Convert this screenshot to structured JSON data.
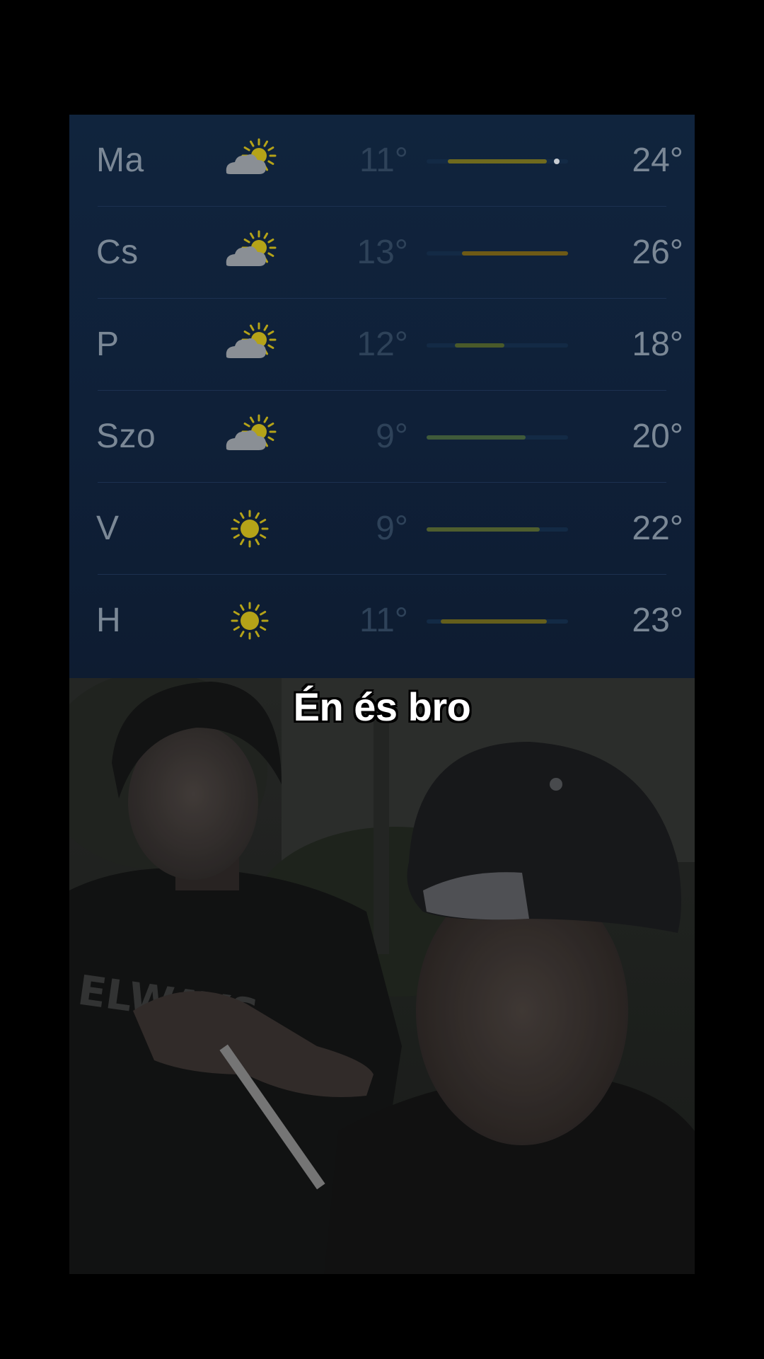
{
  "weather": {
    "days": [
      {
        "day": "Ma",
        "icon": "partly-cloudy-icon",
        "low": "11°",
        "high": "24°",
        "range_start": 0.15,
        "range_end": 0.85,
        "current": 0.92,
        "bar_color": "#6f6a1e"
      },
      {
        "day": "Cs",
        "icon": "partly-cloudy-icon",
        "low": "13°",
        "high": "26°",
        "range_start": 0.25,
        "range_end": 1.0,
        "current": null,
        "bar_color": "#6e5a16"
      },
      {
        "day": "P",
        "icon": "partly-cloudy-icon",
        "low": "12°",
        "high": "18°",
        "range_start": 0.2,
        "range_end": 0.55,
        "current": null,
        "bar_color": "#4a5a2a"
      },
      {
        "day": "Szo",
        "icon": "partly-cloudy-icon",
        "low": "9°",
        "high": "20°",
        "range_start": 0.0,
        "range_end": 0.7,
        "current": null,
        "bar_color": "#3f5a3a"
      },
      {
        "day": "V",
        "icon": "sun-icon",
        "low": "9°",
        "high": "22°",
        "range_start": 0.0,
        "range_end": 0.8,
        "current": null,
        "bar_color": "#4f5e2e"
      },
      {
        "day": "H",
        "icon": "sun-icon",
        "low": "11°",
        "high": "23°",
        "range_start": 0.1,
        "range_end": 0.85,
        "current": null,
        "bar_color": "#645e1c"
      }
    ]
  },
  "caption": "Én és bro",
  "colors": {
    "panel_bg": "#10243d",
    "text_dim": "#7b8896",
    "low_text": "#2e4259",
    "sun": "#b5a318",
    "cloud": "#8a8f95"
  }
}
